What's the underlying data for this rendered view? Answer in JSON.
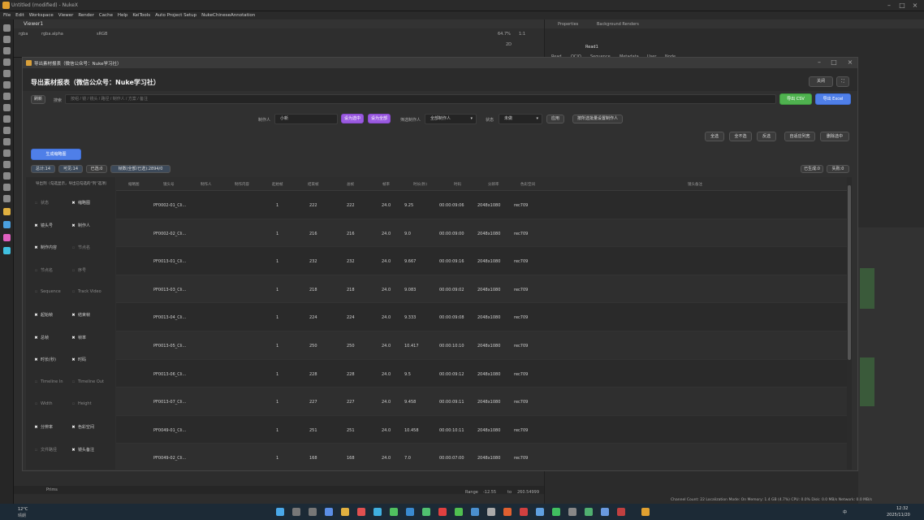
{
  "app": {
    "window_title": "Untitled (modified) - NukeX"
  },
  "menu": [
    "File",
    "Edit",
    "Workspace",
    "Viewer",
    "Render",
    "Cache",
    "Help",
    "KeiTools",
    "Auto Project Setup",
    "NukeChineseAnnotation"
  ],
  "viewer": {
    "tab": "Viewer1",
    "channels": "rgba",
    "layer": "rgba.alpha",
    "colorspace": "sRGB",
    "zoom": "64.7%",
    "ratio": "1:1",
    "mode": "2D",
    "range_label": "Range",
    "range_start": "-12.55",
    "range_to": "to",
    "range_end": "260.54999",
    "playback_mode": "Prims"
  },
  "properties": {
    "tabs": [
      "Properties",
      "Background Renders"
    ],
    "node_name": "Read1",
    "node_tabs": [
      "Read",
      "OCIO",
      "Sequence",
      "Metadata",
      "User",
      "Node"
    ]
  },
  "dialog": {
    "title": "导出素材报表（微信公众号：Nuke学习社）",
    "header": "导出素材报表（微信公众号：Nuke学习社）",
    "refresh_button": "刷新",
    "search_label": "搜索",
    "search_placeholder": "按组 / 镜 / 镜头 / 路径 / 制作人 / 方案 / 备注",
    "export_csv": "导出 CSV",
    "export_excel": "导出 Excel",
    "close_dialog_button": "关闭",
    "assignee_label": "制作人",
    "assignee_value": "小新",
    "assign_selected": "设为选中",
    "assign_all": "设为全部",
    "filter_label": "筛选制作人",
    "filter_value": "全部制作人",
    "status_label": "状态",
    "status_value": "未做",
    "apply_button": "应用",
    "apply_all_button": "按所选批量设置制作人",
    "select_all": "全选",
    "select_none": "全不选",
    "invert": "反选",
    "auto_width": "自适应列宽",
    "delete_selected": "删除选中",
    "add_thumbs": "生成缩略图",
    "stats": {
      "total": "总计:14",
      "shown": "可见:14",
      "selected": "已选:0",
      "frames": "帧数(全部/已选):2894/0"
    },
    "generated": "已生成:0",
    "failed": "失败:0",
    "column_panel_title": "导出列（勾选显示，导出已勾选的“列”选项）",
    "columns_toggle": [
      {
        "label": "状态",
        "on": false
      },
      {
        "label": "缩略图",
        "on": true
      },
      {
        "label": "镜头号",
        "on": true
      },
      {
        "label": "制作人",
        "on": true
      },
      {
        "label": "制作内容",
        "on": true
      },
      {
        "label": "节点名",
        "on": false
      },
      {
        "label": "节点名",
        "on": false
      },
      {
        "label": "序号",
        "on": false
      },
      {
        "label": "Sequence",
        "on": false
      },
      {
        "label": "Track Video",
        "on": false
      },
      {
        "label": "起始帧",
        "on": true
      },
      {
        "label": "结束帧",
        "on": true
      },
      {
        "label": "总帧",
        "on": true
      },
      {
        "label": "帧率",
        "on": true
      },
      {
        "label": "时长(秒)",
        "on": true
      },
      {
        "label": "时码",
        "on": true
      },
      {
        "label": "Timeline In",
        "on": false
      },
      {
        "label": "Timeline Out",
        "on": false
      },
      {
        "label": "Width",
        "on": false
      },
      {
        "label": "Height",
        "on": false
      },
      {
        "label": "分辨率",
        "on": true
      },
      {
        "label": "色彩空间",
        "on": true
      },
      {
        "label": "文件路径",
        "on": false
      },
      {
        "label": "镜头备注",
        "on": true
      }
    ],
    "table": {
      "headers": [
        "缩略图",
        "镜头号",
        "制作人",
        "制作内容",
        "起始帧",
        "结束帧",
        "总帧",
        "帧率",
        "时长(秒)",
        "时码",
        "分辨率",
        "色彩空间",
        "镜头备注"
      ],
      "rows": [
        {
          "shot": "PF0002-01_Cli...",
          "start": "1",
          "end": "222",
          "total": "222",
          "fps": "24.0",
          "dur": "9.25",
          "tc": "00:00:09:06",
          "res": "2048x1080",
          "cs": "rec709"
        },
        {
          "shot": "PF0002-02_Cli...",
          "start": "1",
          "end": "216",
          "total": "216",
          "fps": "24.0",
          "dur": "9.0",
          "tc": "00:00:09:00",
          "res": "2048x1080",
          "cs": "rec709"
        },
        {
          "shot": "PF0013-01_Cli...",
          "start": "1",
          "end": "232",
          "total": "232",
          "fps": "24.0",
          "dur": "9.667",
          "tc": "00:00:09:16",
          "res": "2048x1080",
          "cs": "rec709"
        },
        {
          "shot": "PF0013-03_Cli...",
          "start": "1",
          "end": "218",
          "total": "218",
          "fps": "24.0",
          "dur": "9.083",
          "tc": "00:00:09:02",
          "res": "2048x1080",
          "cs": "rec709"
        },
        {
          "shot": "PF0013-04_Cli...",
          "start": "1",
          "end": "224",
          "total": "224",
          "fps": "24.0",
          "dur": "9.333",
          "tc": "00:00:09:08",
          "res": "2048x1080",
          "cs": "rec709"
        },
        {
          "shot": "PF0013-05_Cli...",
          "start": "1",
          "end": "250",
          "total": "250",
          "fps": "24.0",
          "dur": "10.417",
          "tc": "00:00:10:10",
          "res": "2048x1080",
          "cs": "rec709"
        },
        {
          "shot": "PF0013-06_Cli...",
          "start": "1",
          "end": "228",
          "total": "228",
          "fps": "24.0",
          "dur": "9.5",
          "tc": "00:00:09:12",
          "res": "2048x1080",
          "cs": "rec709"
        },
        {
          "shot": "PF0013-07_Cli...",
          "start": "1",
          "end": "227",
          "total": "227",
          "fps": "24.0",
          "dur": "9.458",
          "tc": "00:00:09:11",
          "res": "2048x1080",
          "cs": "rec709"
        },
        {
          "shot": "PF0049-01_Cli...",
          "start": "1",
          "end": "251",
          "total": "251",
          "fps": "24.0",
          "dur": "10.458",
          "tc": "00:00:10:11",
          "res": "2048x1080",
          "cs": "rec709"
        },
        {
          "shot": "PF0049-02_Cli...",
          "start": "1",
          "end": "168",
          "total": "168",
          "fps": "24.0",
          "dur": "7.0",
          "tc": "00:00:07:00",
          "res": "2048x1080",
          "cs": "rec709"
        }
      ]
    }
  },
  "taskbar": {
    "temp": "12°C",
    "weather": "晴朗",
    "time": "12:32",
    "date": "2025/11/20",
    "lang": "中"
  },
  "status_line": "Channel Count: 22  Localization Mode: On  Memory: 1.4 GB (4.7%)  CPU: 0.0%  Disk: 0.0 MB/s  Network: 0.0 MB/s",
  "colors": {
    "accent_green": "#4fb24f",
    "accent_blue": "#4f7fe8",
    "accent_purple": "#9a5ae0"
  }
}
